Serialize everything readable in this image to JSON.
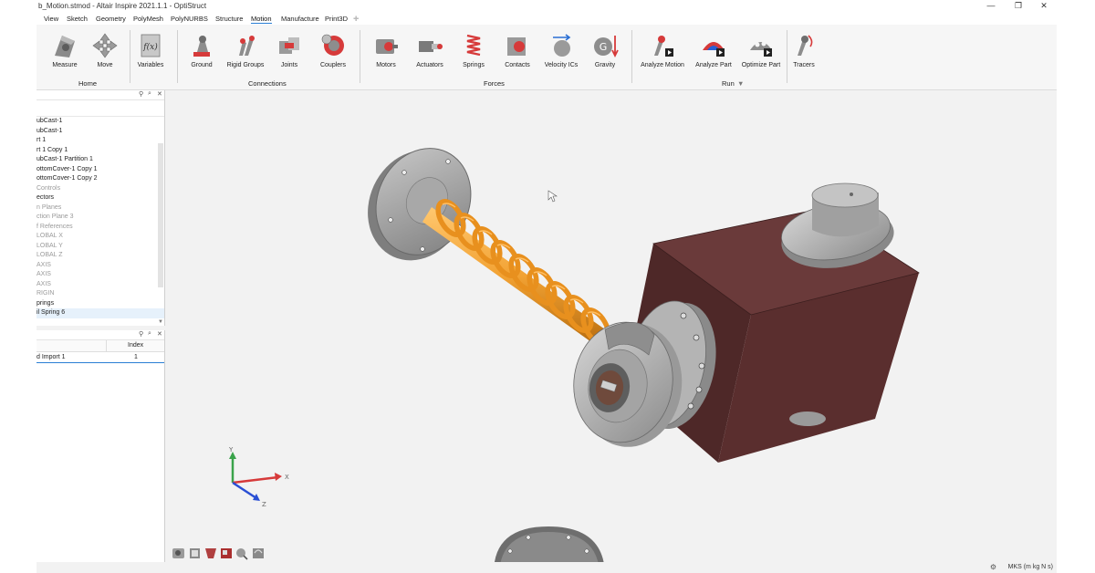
{
  "window": {
    "title": "b_Motion.stmod - Altair Inspire 2021.1.1 - OptiStruct",
    "minimize": "—",
    "maximize": "❐",
    "close": "✕"
  },
  "menu": [
    "View",
    "Sketch",
    "Geometry",
    "PolyMesh",
    "PolyNURBS",
    "Structure",
    "Motion",
    "Manufacture",
    "Print3D"
  ],
  "ribbon": {
    "home": {
      "label": "Home",
      "tools": [
        "Measure",
        "Move"
      ]
    },
    "variables": "Variables",
    "connections": {
      "label": "Connections",
      "tools": [
        "Ground",
        "Rigid Groups",
        "Joints",
        "Couplers"
      ]
    },
    "forces": {
      "label": "Forces",
      "tools": [
        "Motors",
        "Actuators",
        "Springs",
        "Contacts",
        "Velocity ICs",
        "Gravity"
      ]
    },
    "run": {
      "label": "Run",
      "tools": [
        "Analyze Motion",
        "Analyze Part",
        "Optimize Part"
      ]
    },
    "tracers": "Tracers"
  },
  "tree": [
    {
      "label": "ubCast-1",
      "dim": false
    },
    {
      "label": "ubCast-1",
      "dim": false
    },
    {
      "label": "rt 1",
      "dim": false
    },
    {
      "label": "rt 1 Copy 1",
      "dim": false
    },
    {
      "label": "ubCast-1 Partition 1",
      "dim": false
    },
    {
      "label": "ottomCover-1 Copy 1",
      "dim": false
    },
    {
      "label": "ottomCover-1 Copy 2",
      "dim": false
    },
    {
      "label": "Controls",
      "dim": true
    },
    {
      "label": "ectors",
      "dim": false
    },
    {
      "label": "n Planes",
      "dim": true
    },
    {
      "label": "ction Plane 3",
      "dim": true
    },
    {
      "label": "f References",
      "dim": true
    },
    {
      "label": "LOBAL X",
      "dim": true
    },
    {
      "label": "LOBAL Y",
      "dim": true
    },
    {
      "label": "LOBAL Z",
      "dim": true
    },
    {
      "label": "AXIS",
      "dim": true
    },
    {
      "label": "AXIS",
      "dim": true
    },
    {
      "label": "AXIS",
      "dim": true
    },
    {
      "label": "RIGIN",
      "dim": true
    },
    {
      "label": "prings",
      "dim": false
    },
    {
      "label": "il Spring 6",
      "dim": false,
      "selected": true
    }
  ],
  "table": {
    "header": "Index",
    "rows": [
      {
        "name": "d Import 1",
        "index": "1"
      }
    ]
  },
  "axes": {
    "x": "X",
    "y": "Y",
    "z": "Z"
  },
  "status": "MKS (m kg N s)",
  "colors": {
    "accent": "#2a7fd4",
    "block": "#5a2e2e",
    "spring": "#f2a233",
    "metal": "#9a9a9a"
  }
}
